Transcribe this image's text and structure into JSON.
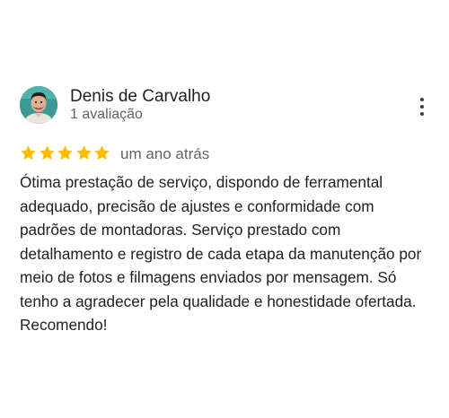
{
  "review": {
    "reviewer": {
      "name": "Denis de Carvalho",
      "review_count": "1 avaliação",
      "avatar_icon": "profile-photo"
    },
    "more_options_icon": "more-vert-icon",
    "rating": 5,
    "max_rating": 5,
    "star_color": "#fbbc04",
    "date": "um ano atrás",
    "text": "Ótima prestação de serviço, dispondo de ferramental adequado, precisão de ajustes e conformidade com padrões de montadoras. Serviço prestado com detalhamento e registro de cada etapa da manutenção por meio de fotos e filmagens enviados por mensagem. Só tenho a agradecer pela qualidade e honestidade ofertada. Recomendo!"
  }
}
